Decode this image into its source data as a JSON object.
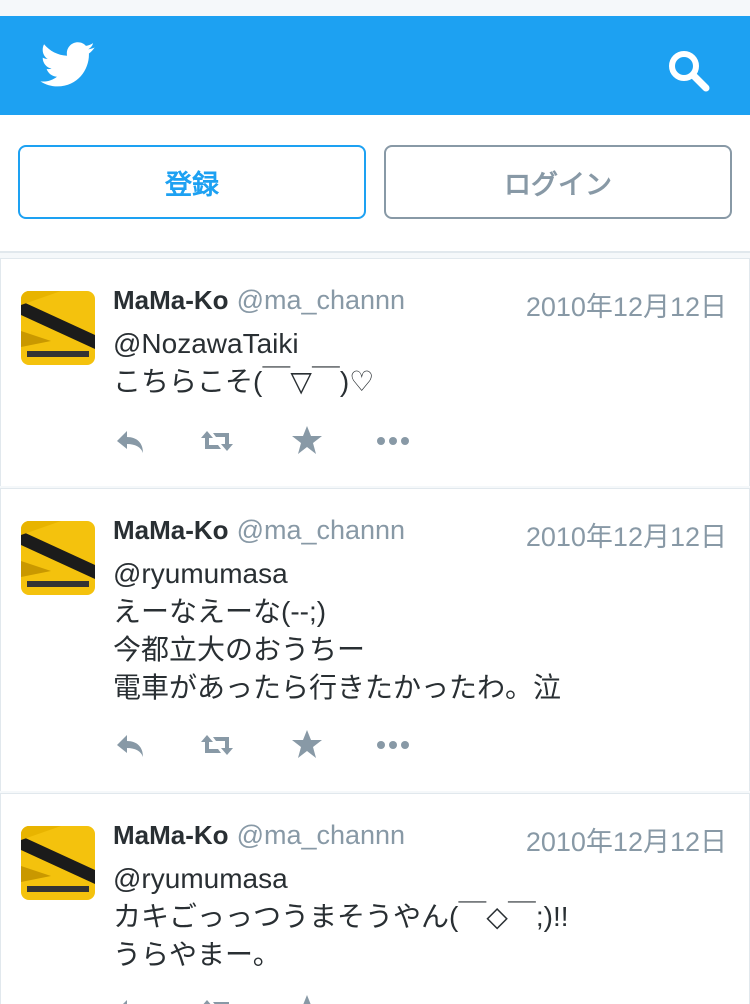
{
  "header": {
    "logo_icon": "twitter-bird-icon",
    "search_icon": "search-icon",
    "brand_color": "#1da1f2"
  },
  "auth": {
    "signup_label": "登録",
    "login_label": "ログイン"
  },
  "tweets": [
    {
      "name": "MaMa-Ko",
      "handle": "@ma_channn",
      "date": "2010年12月12日",
      "lines": [
        "@NozawaTaiki",
        "こちらこそ(￣▽￣)♡"
      ]
    },
    {
      "name": "MaMa-Ko",
      "handle": "@ma_channn",
      "date": "2010年12月12日",
      "lines": [
        "@ryumumasa",
        "えーなえーな(--;)",
        "今都立大のおうちー",
        "電車があったら行きたかったわ。泣"
      ]
    },
    {
      "name": "MaMa-Ko",
      "handle": "@ma_channn",
      "date": "2010年12月12日",
      "lines": [
        "@ryumumasa",
        "カキごっっつうまそうやん(￣◇￣;)!!",
        "うらやまー。"
      ]
    }
  ],
  "action_icons": [
    "reply-icon",
    "retweet-icon",
    "favorite-star-icon",
    "more-dots-icon"
  ],
  "colors": {
    "text": "#292f33",
    "muted": "#8899a6",
    "border": "#e1e8ed"
  }
}
